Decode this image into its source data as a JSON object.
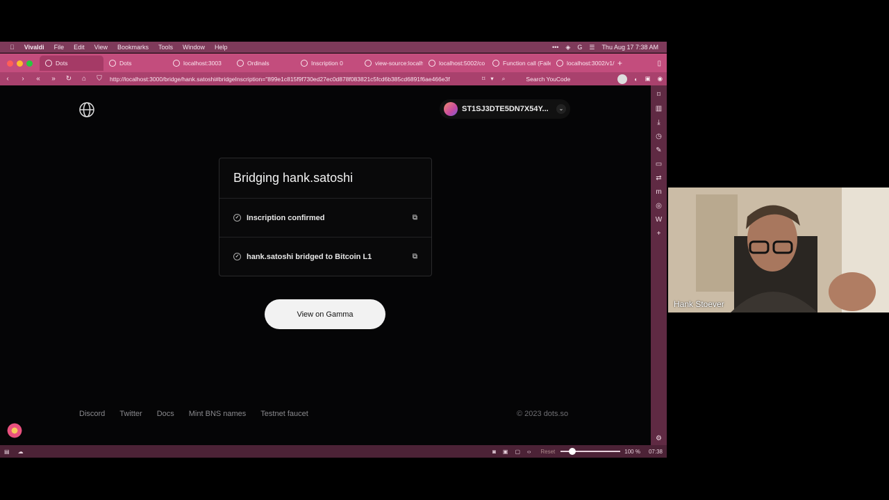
{
  "menubar": {
    "app": "Vivaldi",
    "items": [
      "File",
      "Edit",
      "View",
      "Bookmarks",
      "Tools",
      "Window",
      "Help"
    ],
    "datetime": "Thu Aug 17  7:38 AM"
  },
  "tabs": [
    {
      "label": "Dots"
    },
    {
      "label": "Dots"
    },
    {
      "label": "localhost:3003"
    },
    {
      "label": "Ordinals"
    },
    {
      "label": "Inscription 0"
    },
    {
      "label": "view-source:localh"
    },
    {
      "label": "localhost:5002/co"
    },
    {
      "label": "Function call (Faile"
    },
    {
      "label": "localhost:3002/v1/"
    }
  ],
  "addressbar": {
    "url": "http://localhost:3000/bridge/hank.satoshi#bridgeInscription=\"899e1c815f9f730ed27ec0d878f083821c5fcd6b385cd6891f6ae466e3f",
    "search_placeholder": "Search YouCode"
  },
  "page": {
    "wallet_address": "ST1SJ3DTE5DN7X54Y...",
    "card_title": "Bridging hank.satoshi",
    "steps": [
      {
        "label": "Inscription confirmed"
      },
      {
        "label": "hank.satoshi bridged to Bitcoin L1"
      }
    ],
    "cta_label": "View on Gamma",
    "footer_links": [
      "Discord",
      "Twitter",
      "Docs",
      "Mint BNS names",
      "Testnet faucet"
    ],
    "copyright": "© 2023 dots.so"
  },
  "statusbar": {
    "reset_label": "Reset",
    "zoom": "100 %",
    "clock": "07:38"
  },
  "webcam": {
    "name": "Hank Stoever"
  },
  "colors": {
    "menubar": "#7e3a5a",
    "tabbar": "#c34d7d",
    "page_bg": "#050506",
    "button_bg": "#f2f2f2"
  }
}
